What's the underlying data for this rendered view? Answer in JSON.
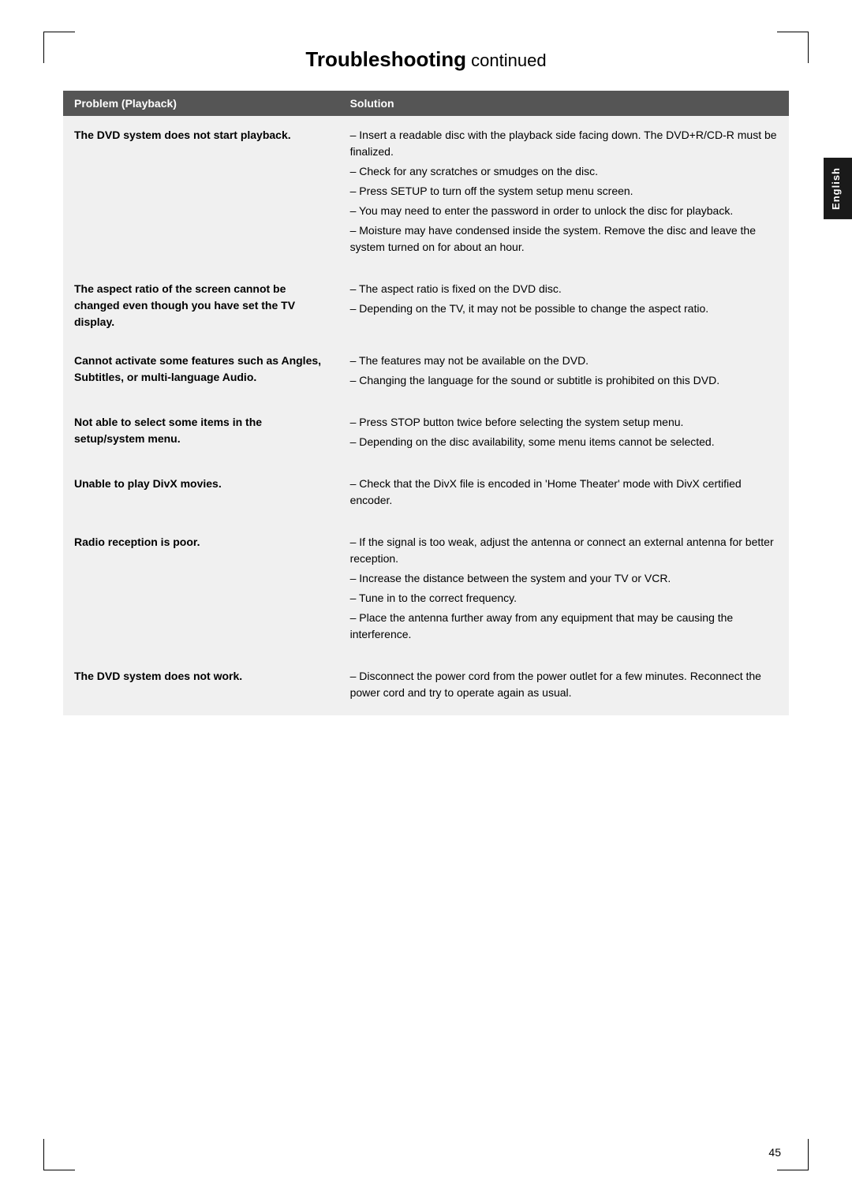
{
  "page": {
    "title": "Troubleshooting",
    "title_suffix": " continued",
    "page_number": "45"
  },
  "side_tab": {
    "label": "English"
  },
  "table": {
    "headers": [
      "Problem (Playback)",
      "Solution"
    ],
    "rows": [
      {
        "problem": "The DVD system does not start playback.",
        "solutions": [
          "Insert a readable disc with the playback side facing down. The DVD+R/CD-R must be finalized.",
          "Check for any scratches or smudges on the disc.",
          "Press SETUP to turn off the system setup menu screen.",
          "You may need to enter the password in order to unlock the disc for playback.",
          "Moisture may have condensed inside the system. Remove the disc and leave the system turned on for about an hour."
        ]
      },
      {
        "problem": "The aspect ratio of the screen cannot be changed even though you have set the TV display.",
        "solutions": [
          "The aspect ratio is fixed on the DVD disc.",
          "Depending on the TV, it may not be possible to change the aspect ratio."
        ]
      },
      {
        "problem": "Cannot activate some features such as Angles, Subtitles, or multi-language Audio.",
        "solutions": [
          "The features may not be available on the DVD.",
          "Changing the language for the sound or subtitle is prohibited on this DVD."
        ]
      },
      {
        "problem": "Not able to select some items in the setup/system menu.",
        "solutions": [
          "Press STOP button twice before selecting the system setup menu.",
          "Depending on the disc availability, some menu items cannot be selected."
        ]
      },
      {
        "problem": "Unable to play DivX movies.",
        "solutions": [
          "Check that the DivX file is encoded in 'Home Theater' mode with DivX certified encoder."
        ]
      },
      {
        "problem": "Radio reception is poor.",
        "solutions": [
          "If the signal is too weak, adjust the antenna or connect an external antenna for better reception.",
          "Increase the distance between the system and your TV or VCR.",
          "Tune in to the correct frequency.",
          "Place the antenna further away from any equipment that may be causing the interference."
        ]
      },
      {
        "problem": "The DVD system does not work.",
        "solutions": [
          "Disconnect the power cord from the power outlet for a few minutes. Reconnect the power cord and try to operate again as usual."
        ]
      }
    ]
  }
}
